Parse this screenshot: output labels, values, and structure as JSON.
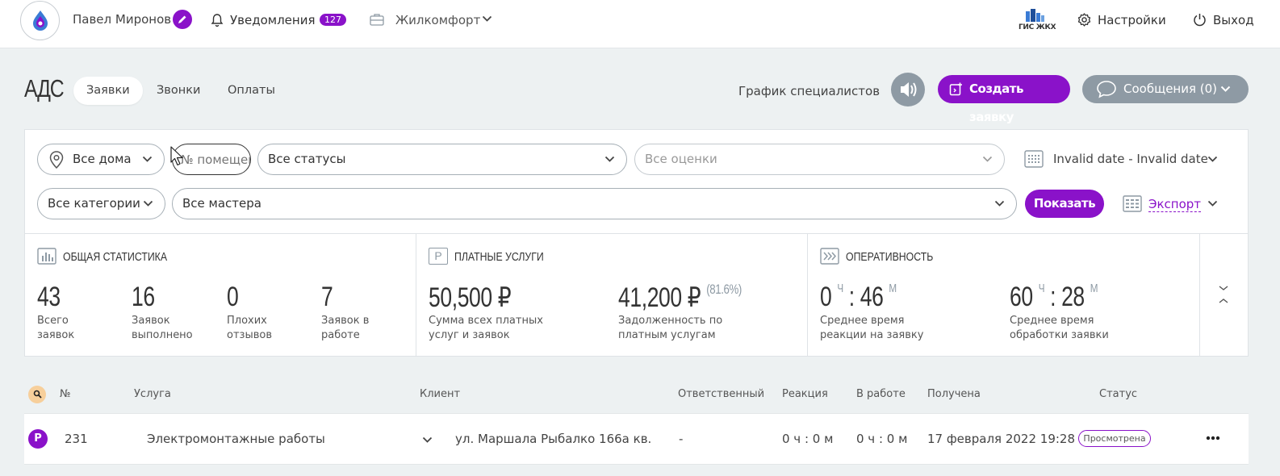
{
  "topbar": {
    "user_name": "Павел Миронов",
    "notifications_label": "Уведомления",
    "notifications_count": "127",
    "organization": "Жилкомфорт",
    "gis_label": "ГИС ЖКХ",
    "settings_label": "Настройки",
    "exit_label": "Выход"
  },
  "header": {
    "title": "АДС",
    "tabs": [
      {
        "label": "Заявки",
        "active": true
      },
      {
        "label": "Звонки",
        "active": false
      },
      {
        "label": "Оплаты",
        "active": false
      }
    ],
    "schedule_link": "График специалистов",
    "create_button": "Создать заявку",
    "messages_button": "Сообщения (0)"
  },
  "filters": {
    "houses": "Все дома",
    "room_placeholder": "№ помещения",
    "statuses": "Все статусы",
    "ratings": "Все оценки",
    "date_range": "Invalid date - Invalid date",
    "categories": "Все категории",
    "masters": "Все мастера",
    "show_button": "Показать",
    "export_label": "Экспорт"
  },
  "stats": {
    "general": {
      "title": "ОБЩАЯ СТАТИСТИКА",
      "items": [
        {
          "value": "43",
          "label_1": "Всего",
          "label_2": "заявок"
        },
        {
          "value": "16",
          "label_1": "Заявок",
          "label_2": "выполнено"
        },
        {
          "value": "0",
          "label_1": "Плохих",
          "label_2": "отзывов"
        },
        {
          "value": "7",
          "label_1": "Заявок в",
          "label_2": "работе"
        }
      ]
    },
    "paid": {
      "title": "ПЛАТНЫЕ УСЛУГИ",
      "icon_letter": "Р",
      "total_value": "50,500 ₽",
      "total_label_1": "Сумма всех платных",
      "total_label_2": "услуг и заявок",
      "debt_value": "41,200 ₽",
      "debt_percent": "(81.6%)",
      "debt_label_1": "Задолженность по",
      "debt_label_2": "платным услугам"
    },
    "efficiency": {
      "title": "ОПЕРАТИВНОСТЬ",
      "reaction_hours": "0",
      "reaction_minutes": "46",
      "reaction_label_1": "Среднее время",
      "reaction_label_2": "реакции на заявку",
      "processing_hours": "60",
      "processing_minutes": "28",
      "processing_label_1": "Среднее время",
      "processing_label_2": "обработки заявки",
      "hours_unit": "Ч",
      "minutes_unit": "М",
      "separator": ":"
    }
  },
  "table": {
    "headers": {
      "number": "№",
      "service": "Услуга",
      "client": "Клиент",
      "responsible": "Ответственный",
      "reaction": "Реакция",
      "in_work": "В работе",
      "received": "Получена",
      "status": "Статус"
    },
    "rows": [
      {
        "type_icon": "Р",
        "number": "231",
        "service": "Электромонтажные работы",
        "client": "ул. Маршала Рыбалко 166а кв.",
        "responsible": "-",
        "reaction": "0 ч : 0 м",
        "in_work": "0 ч : 0 м",
        "received": "17 февраля 2022 19:28",
        "status": "Просмотрена"
      }
    ]
  },
  "colors": {
    "accent": "#8a12c9",
    "gray_button": "#8e9aa4",
    "background": "#edf1f2"
  }
}
